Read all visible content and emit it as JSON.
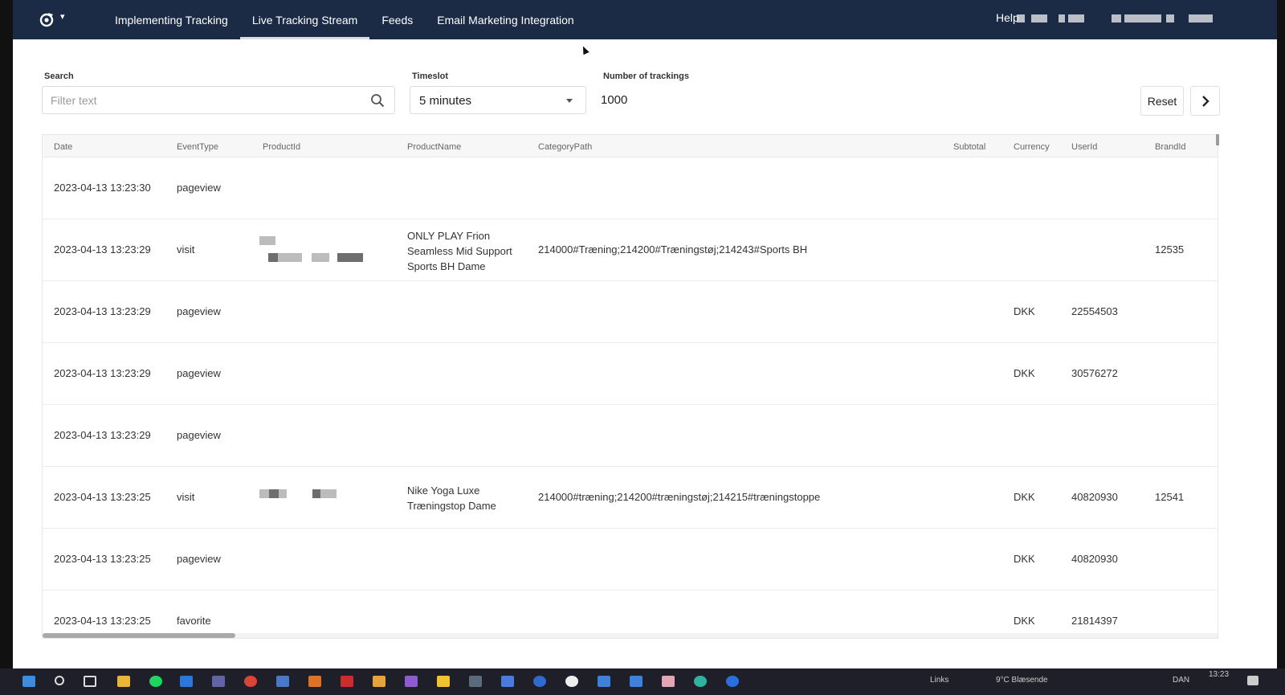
{
  "nav": {
    "logo": "app-logo-icon",
    "items": [
      {
        "label": "Implementing Tracking"
      },
      {
        "label": "Live Tracking Stream"
      },
      {
        "label": "Feeds"
      },
      {
        "label": "Email Marketing Integration"
      }
    ],
    "active_index": 1,
    "help": "Help"
  },
  "filters": {
    "search_label": "Search",
    "search_placeholder": "Filter text",
    "timeslot_label": "Timeslot",
    "timeslot_value": "5 minutes",
    "count_label": "Number of trackings",
    "count_value": "1000",
    "reset": "Reset"
  },
  "table": {
    "columns": [
      "Date",
      "EventType",
      "ProductId",
      "ProductName",
      "CategoryPath",
      "Subtotal",
      "Currency",
      "UserId",
      "BrandId"
    ],
    "rows": [
      {
        "date": "2023-04-13 13:23:30",
        "event": "pageview",
        "product": "",
        "category": "",
        "subtotal": "",
        "currency": "",
        "user": "",
        "brand": ""
      },
      {
        "date": "2023-04-13 13:23:29",
        "event": "visit",
        "product": "ONLY PLAY Frion Seamless Mid Support Sports BH Dame",
        "category": "214000#Træning;214200#Træningstøj;214243#Sports BH",
        "subtotal": "",
        "currency": "",
        "user": "",
        "brand": "12535"
      },
      {
        "date": "2023-04-13 13:23:29",
        "event": "pageview",
        "product": "",
        "category": "",
        "subtotal": "",
        "currency": "DKK",
        "user": "22554503",
        "brand": ""
      },
      {
        "date": "2023-04-13 13:23:29",
        "event": "pageview",
        "product": "",
        "category": "",
        "subtotal": "",
        "currency": "DKK",
        "user": "30576272",
        "brand": ""
      },
      {
        "date": "2023-04-13 13:23:29",
        "event": "pageview",
        "product": "",
        "category": "",
        "subtotal": "",
        "currency": "",
        "user": "",
        "brand": ""
      },
      {
        "date": "2023-04-13 13:23:25",
        "event": "visit",
        "product": "Nike Yoga Luxe Træningstop Dame",
        "category": "214000#træning;214200#træningstøj;214215#træningstoppe",
        "subtotal": "",
        "currency": "DKK",
        "user": "40820930",
        "brand": "12541"
      },
      {
        "date": "2023-04-13 13:23:25",
        "event": "pageview",
        "product": "",
        "category": "",
        "subtotal": "",
        "currency": "DKK",
        "user": "40820930",
        "brand": ""
      },
      {
        "date": "2023-04-13 13:23:25",
        "event": "favorite",
        "product": "",
        "category": "",
        "subtotal": "",
        "currency": "DKK",
        "user": "21814397",
        "brand": ""
      }
    ]
  },
  "taskbar": {
    "links": "Links",
    "weather": "9°C  Blæsende",
    "lang": "DAN",
    "time": "13:23"
  }
}
